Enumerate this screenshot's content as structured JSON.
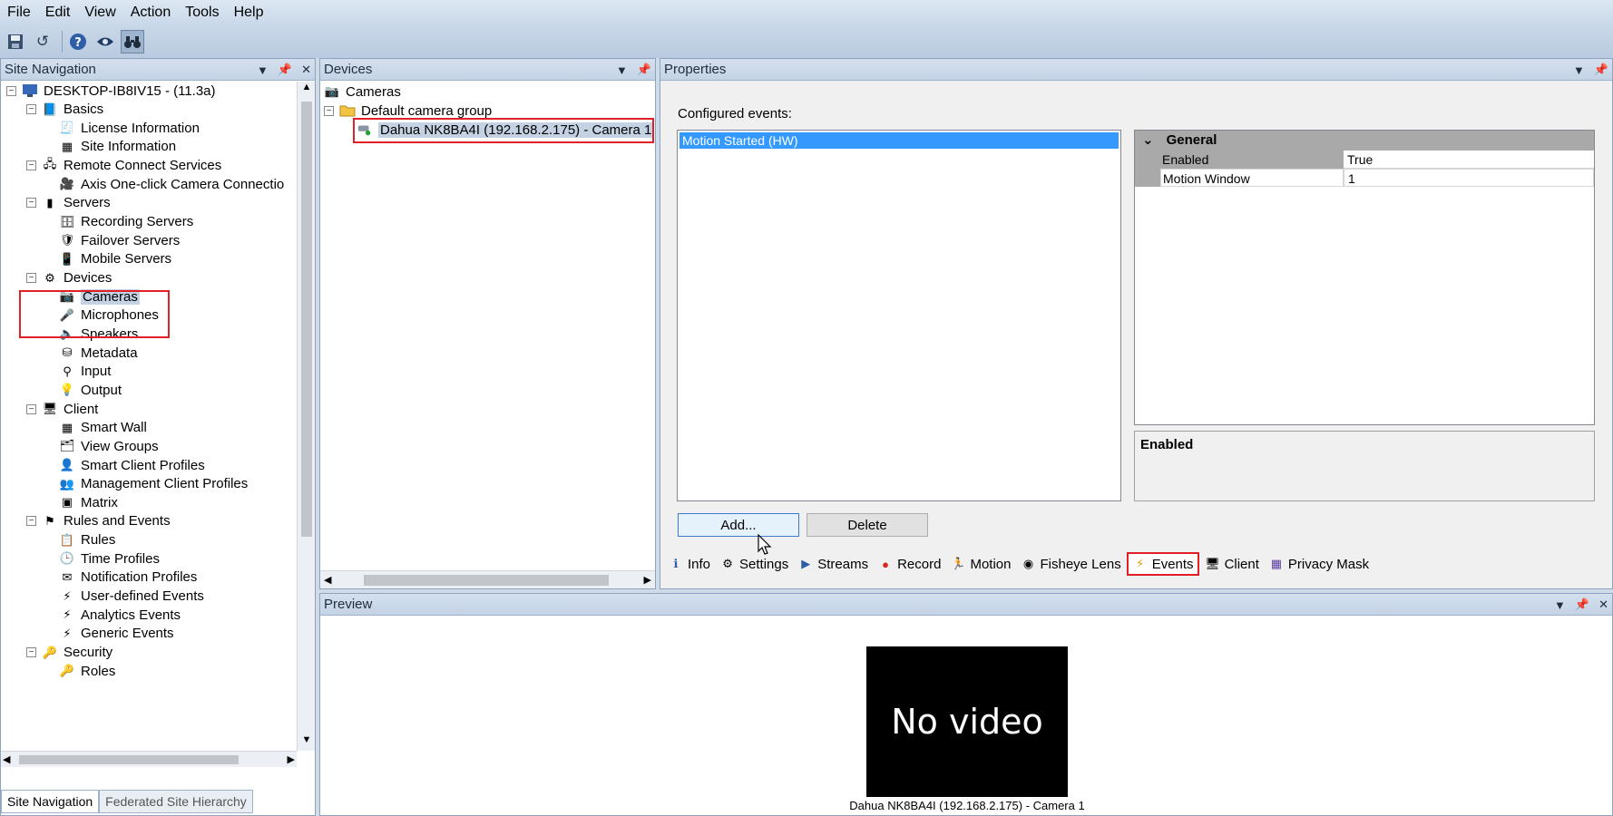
{
  "menu": [
    "File",
    "Edit",
    "View",
    "Action",
    "Tools",
    "Help"
  ],
  "toolbar": {
    "icons": [
      "save-icon",
      "undo-icon",
      "help-icon",
      "eye-icon",
      "binoculars-icon"
    ]
  },
  "site_navigation": {
    "title": "Site Navigation",
    "root": "DESKTOP-IB8IV15 - (11.3a)",
    "items": [
      {
        "label": "Basics",
        "level": 1,
        "icon": "book-icon"
      },
      {
        "label": "License Information",
        "level": 2,
        "icon": "license-icon"
      },
      {
        "label": "Site Information",
        "level": 2,
        "icon": "info-grid-icon"
      },
      {
        "label": "Remote Connect Services",
        "level": 1,
        "icon": "remote-icon"
      },
      {
        "label": "Axis One-click Camera Connectio",
        "level": 2,
        "icon": "axis-icon"
      },
      {
        "label": "Servers",
        "level": 1,
        "icon": "server-icon"
      },
      {
        "label": "Recording Servers",
        "level": 2,
        "icon": "recording-server-icon"
      },
      {
        "label": "Failover Servers",
        "level": 2,
        "icon": "failover-server-icon"
      },
      {
        "label": "Mobile Servers",
        "level": 2,
        "icon": "mobile-server-icon"
      },
      {
        "label": "Devices",
        "level": 1,
        "icon": "devices-icon"
      },
      {
        "label": "Cameras",
        "level": 2,
        "icon": "camera-icon"
      },
      {
        "label": "Microphones",
        "level": 2,
        "icon": "microphone-icon"
      },
      {
        "label": "Speakers",
        "level": 2,
        "icon": "speaker-icon"
      },
      {
        "label": "Metadata",
        "level": 2,
        "icon": "metadata-icon"
      },
      {
        "label": "Input",
        "level": 2,
        "icon": "input-icon"
      },
      {
        "label": "Output",
        "level": 2,
        "icon": "output-bulb-icon"
      },
      {
        "label": "Client",
        "level": 1,
        "icon": "client-icon"
      },
      {
        "label": "Smart Wall",
        "level": 2,
        "icon": "smart-wall-icon"
      },
      {
        "label": "View Groups",
        "level": 2,
        "icon": "view-groups-icon"
      },
      {
        "label": "Smart Client Profiles",
        "level": 2,
        "icon": "smart-client-profile-icon"
      },
      {
        "label": "Management Client Profiles",
        "level": 2,
        "icon": "management-client-profile-icon"
      },
      {
        "label": "Matrix",
        "level": 2,
        "icon": "matrix-icon"
      },
      {
        "label": "Rules and Events",
        "level": 1,
        "icon": "rules-events-icon"
      },
      {
        "label": "Rules",
        "level": 2,
        "icon": "rules-icon"
      },
      {
        "label": "Time Profiles",
        "level": 2,
        "icon": "clock-icon"
      },
      {
        "label": "Notification Profiles",
        "level": 2,
        "icon": "envelope-icon"
      },
      {
        "label": "User-defined Events",
        "level": 2,
        "icon": "user-event-icon"
      },
      {
        "label": "Analytics Events",
        "level": 2,
        "icon": "analytics-event-icon"
      },
      {
        "label": "Generic Events",
        "level": 2,
        "icon": "generic-event-icon"
      },
      {
        "label": "Security",
        "level": 1,
        "icon": "security-keys-icon"
      },
      {
        "label": "Roles",
        "level": 2,
        "icon": "roles-key-icon"
      }
    ],
    "bottom_tabs": [
      "Site Navigation",
      "Federated Site Hierarchy"
    ]
  },
  "devices": {
    "title": "Devices",
    "root": "Cameras",
    "group": "Default camera group",
    "camera": "Dahua NK8BA4I (192.168.2.175) - Camera 1"
  },
  "properties": {
    "title": "Properties",
    "configured_label": "Configured events:",
    "events": [
      "Motion Started (HW)"
    ],
    "grid_section": "General",
    "grid_rows": [
      {
        "name": "Enabled",
        "value": "True"
      },
      {
        "name": "Motion Window",
        "value": "1"
      }
    ],
    "description_title": "Enabled",
    "add_label": "Add...",
    "delete_label": "Delete",
    "tabs": [
      {
        "label": "Info",
        "icon": "info-icon"
      },
      {
        "label": "Settings",
        "icon": "settings-icon"
      },
      {
        "label": "Streams",
        "icon": "streams-icon"
      },
      {
        "label": "Record",
        "icon": "record-icon"
      },
      {
        "label": "Motion",
        "icon": "motion-icon"
      },
      {
        "label": "Fisheye Lens",
        "icon": "fisheye-icon"
      },
      {
        "label": "Events",
        "icon": "events-icon"
      },
      {
        "label": "Client",
        "icon": "client-monitor-icon"
      },
      {
        "label": "Privacy Mask",
        "icon": "privacy-mask-icon"
      }
    ],
    "active_tab": "Events"
  },
  "preview": {
    "title": "Preview",
    "no_video": "No video",
    "caption": "Dahua NK8BA4I (192.168.2.175) - Camera 1"
  }
}
